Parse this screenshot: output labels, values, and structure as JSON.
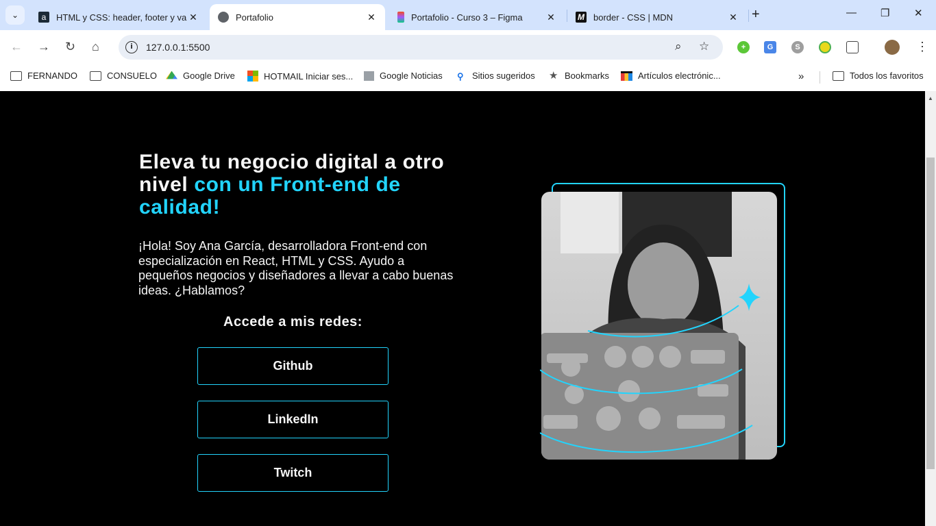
{
  "browser": {
    "tabs": [
      {
        "title": "HTML y CSS: header, footer y va",
        "icon": "alura-icon"
      },
      {
        "title": "Portafolio",
        "icon": "globe-icon",
        "active": true
      },
      {
        "title": "Portafolio - Curso 3 – Figma",
        "icon": "figma-icon"
      },
      {
        "title": "border - CSS | MDN",
        "icon": "mdn-icon"
      }
    ],
    "url": "127.0.0.1:5500",
    "bookmarks": [
      {
        "label": "FERNANDO",
        "icon": "folder-icon"
      },
      {
        "label": "CONSUELO",
        "icon": "folder-icon"
      },
      {
        "label": "Google Drive",
        "icon": "google-drive-icon"
      },
      {
        "label": "HOTMAIL Iniciar ses...",
        "icon": "microsoft-icon"
      },
      {
        "label": "Google Noticias",
        "icon": "news-icon"
      },
      {
        "label": "Sitios sugeridos",
        "icon": "search-icon"
      },
      {
        "label": "Bookmarks",
        "icon": "star-icon"
      },
      {
        "label": "Artículos electrónic...",
        "icon": "shop-icon"
      }
    ],
    "all_bookmarks": "Todos los favoritos",
    "overflow": "»"
  },
  "hero": {
    "title_plain": "Eleva tu negocio digital a otro nivel ",
    "title_highlight": "con un Front-end de calidad!",
    "intro": "¡Hola! Soy Ana García, desarrolladora Front-end con especialización en React, HTML y CSS. Ayudo a pequeños negocios y diseñadores a llevar a cabo buenas ideas. ¿Hablamos?",
    "social_heading": "Accede a mis redes:",
    "buttons": [
      "Github",
      "LinkedIn",
      "Twitch"
    ],
    "accent_color": "#22d4fd"
  }
}
